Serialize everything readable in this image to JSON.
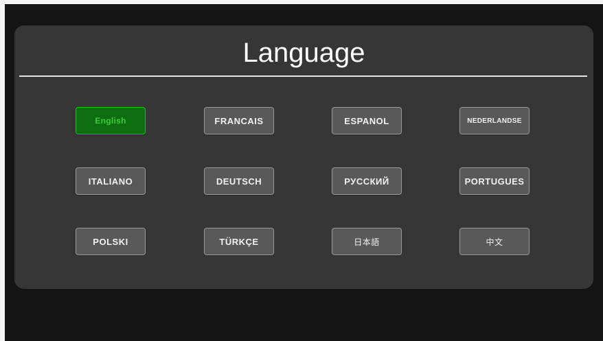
{
  "title": "Language",
  "colors": {
    "panel": "#363636",
    "screen": "#141414",
    "button": "#595959",
    "selected_fill": "#0d6d10",
    "selected_text": "#33d133"
  },
  "languages": [
    {
      "label": "English",
      "selected": true
    },
    {
      "label": "FRANCAIS",
      "selected": false
    },
    {
      "label": "ESPANOL",
      "selected": false
    },
    {
      "label": "NEDERLANDSE",
      "selected": false
    },
    {
      "label": "ITALIANO",
      "selected": false
    },
    {
      "label": "DEUTSCH",
      "selected": false
    },
    {
      "label": "РУССКИЙ",
      "selected": false
    },
    {
      "label": "PORTUGUES",
      "selected": false
    },
    {
      "label": "POLSKI",
      "selected": false
    },
    {
      "label": "TÜRKÇE",
      "selected": false
    },
    {
      "label": "日本語",
      "selected": false
    },
    {
      "label": "中文",
      "selected": false
    }
  ]
}
